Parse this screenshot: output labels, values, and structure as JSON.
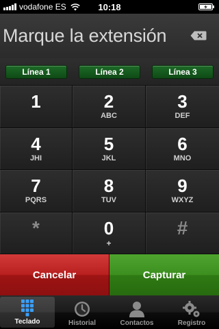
{
  "status_bar": {
    "carrier": "vodafone ES",
    "time": "10:18"
  },
  "header": {
    "title": "Marque la extensión"
  },
  "lines": [
    {
      "label": "Línea 1"
    },
    {
      "label": "Línea 2"
    },
    {
      "label": "Línea 3"
    }
  ],
  "keypad": [
    {
      "digit": "1",
      "letters": ""
    },
    {
      "digit": "2",
      "letters": "ABC"
    },
    {
      "digit": "3",
      "letters": "DEF"
    },
    {
      "digit": "4",
      "letters": "JHI"
    },
    {
      "digit": "5",
      "letters": "JKL"
    },
    {
      "digit": "6",
      "letters": "MNO"
    },
    {
      "digit": "7",
      "letters": "PQRS"
    },
    {
      "digit": "8",
      "letters": "TUV"
    },
    {
      "digit": "9",
      "letters": "WXYZ"
    },
    {
      "digit": "*",
      "letters": ""
    },
    {
      "digit": "0",
      "letters": "+"
    },
    {
      "digit": "#",
      "letters": ""
    }
  ],
  "actions": {
    "cancel": "Cancelar",
    "capture": "Capturar"
  },
  "tabs": [
    {
      "label": "Teclado",
      "icon": "keypad-icon",
      "active": true
    },
    {
      "label": "Historial",
      "icon": "clock-icon",
      "active": false
    },
    {
      "label": "Contactos",
      "icon": "contacts-icon",
      "active": false
    },
    {
      "label": "Registro",
      "icon": "gear-icon",
      "active": false
    }
  ],
  "colors": {
    "line_button": "#1d6b27",
    "cancel": "#b81f1f",
    "capture": "#3c8f1f"
  }
}
